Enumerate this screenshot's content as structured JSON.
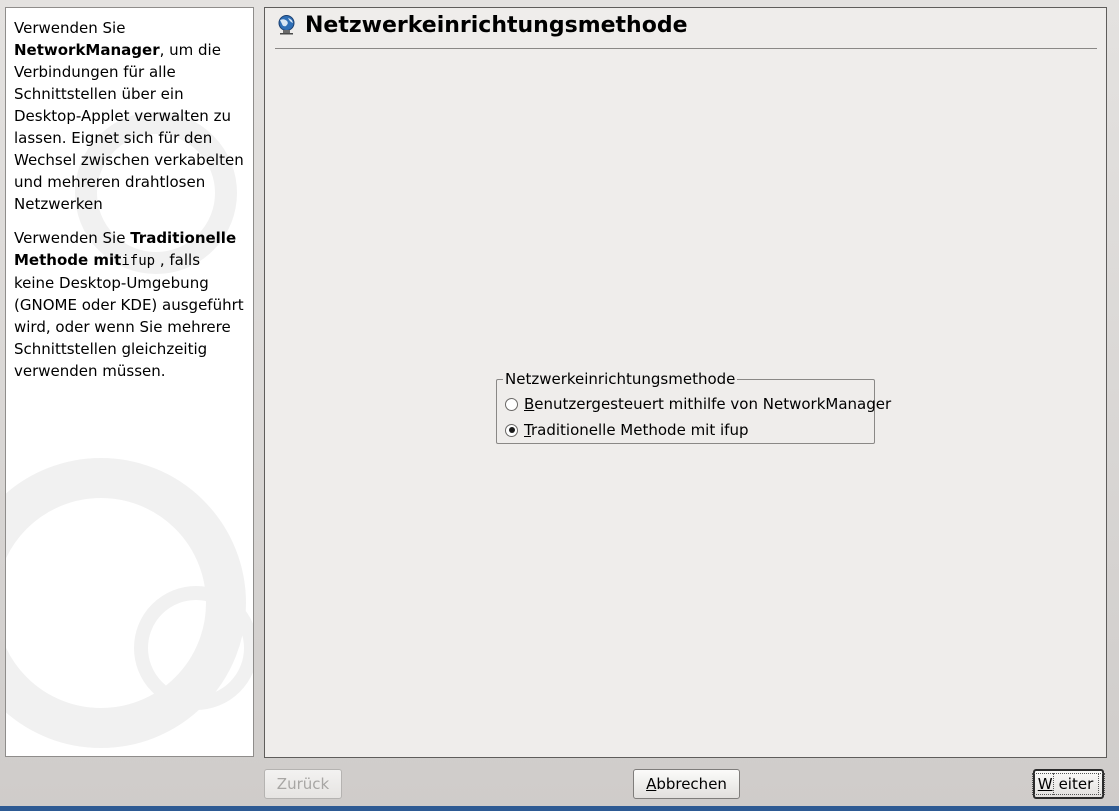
{
  "help": {
    "p1_intro": "Verwenden Sie ",
    "p1_bold": "NetworkManager",
    "p1_rest": ", um die Verbindungen für alle Schnittstellen über ein Desktop-Applet verwalten zu lassen. Eignet sich für den Wechsel zwischen verkabelten und mehreren drahtlosen Netzwerken",
    "p2_intro": "Verwenden Sie ",
    "p2_bold": "Traditionelle Methode mit",
    "p2_code": "ifup",
    "p2_rest": ", falls keine Desktop-Umgebung (GNOME oder KDE) ausgeführt wird, oder wenn Sie mehrere Schnittstellen gleichzeitig verwenden müssen."
  },
  "main": {
    "title": "Netzwerkeinrichtungsmethode",
    "group": {
      "legend": "Netzwerkeinrichtungsmethode",
      "options": [
        {
          "mnemonic": "B",
          "label_rest": "enutzergesteuert mithilfe von NetworkManager",
          "selected": false
        },
        {
          "mnemonic": "T",
          "label_rest": "raditionelle Methode mit ifup",
          "selected": true
        }
      ]
    }
  },
  "buttons": {
    "back": {
      "label": "Zurück",
      "enabled": false
    },
    "cancel": {
      "mnemonic": "A",
      "label_rest": "bbrechen"
    },
    "next": {
      "mnemonic": "W",
      "label_rest": "eiter"
    }
  },
  "colors": {
    "bottom_bar": "#2d5a93"
  }
}
